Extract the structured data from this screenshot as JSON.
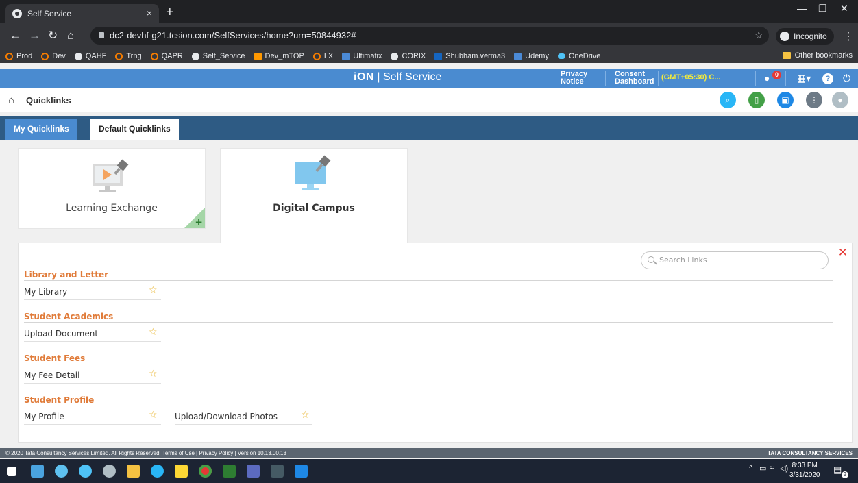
{
  "browser": {
    "tab_title": "Self Service",
    "close_glyph": "×",
    "newtab_glyph": "+",
    "url": "dc2-devhf-g21.tcsion.com/SelfServices/home?urn=50844932#",
    "incognito_label": "Incognito",
    "bookmarks": [
      {
        "label": "Prod",
        "icon": "ring"
      },
      {
        "label": "Dev",
        "icon": "ring"
      },
      {
        "label": "QAHF",
        "icon": "globe"
      },
      {
        "label": "Trng",
        "icon": "ring"
      },
      {
        "label": "QAPR",
        "icon": "ring"
      },
      {
        "label": "Self_Service",
        "icon": "globe"
      },
      {
        "label": "Dev_mTOP",
        "icon": "m"
      },
      {
        "label": "LX",
        "icon": "ring"
      },
      {
        "label": "Ultimatix",
        "icon": "sq"
      },
      {
        "label": "CORIX",
        "icon": "globe"
      },
      {
        "label": "Shubham.verma3",
        "icon": "o"
      },
      {
        "label": "Udemy",
        "icon": "sq"
      },
      {
        "label": "OneDrive",
        "icon": "cloud"
      }
    ],
    "other_bookmarks": "Other bookmarks"
  },
  "header": {
    "brand": "iON",
    "brand_suffix": "| Self Service",
    "privacy_line1": "Privacy",
    "privacy_line2": "Notice",
    "consent_line1": "Consent",
    "consent_line2": "Dashboard",
    "timezone": "(GMT+05:30) C...",
    "notification_count": "0"
  },
  "breadcrumb": {
    "title": "Quicklinks"
  },
  "tabs": {
    "my_quicklinks": "My Quicklinks",
    "default_quicklinks": "Default Quicklinks"
  },
  "tiles": [
    {
      "label": "Learning Exchange",
      "add_glyph": "+"
    },
    {
      "label": "Digital Campus"
    }
  ],
  "panel": {
    "search_placeholder": "Search Links",
    "close_glyph": "✕",
    "star_glyph": "☆",
    "sections": [
      {
        "title": "Library and Letter",
        "links": [
          "My Library"
        ]
      },
      {
        "title": "Student Academics",
        "links": [
          "Upload Document"
        ]
      },
      {
        "title": "Student Fees",
        "links": [
          "My Fee Detail"
        ]
      },
      {
        "title": "Student Profile",
        "links": [
          "My Profile",
          "Upload/Download Photos"
        ]
      }
    ]
  },
  "footer": {
    "text": "© 2020 Tata Consultancy Services Limited. All Rights Reserved.   Terms of Use | Privacy Policy | Version 10.13.00.13",
    "brand": "TATA CONSULTANCY SERVICES"
  },
  "taskbar": {
    "time": "8:33 PM",
    "date": "3/31/2020",
    "notification_count": "2"
  },
  "colors": {
    "app_blue": "#4a8bd0",
    "tab_bar": "#2e5b84",
    "section_orange": "#e07b39",
    "star": "#e9b52e",
    "timezone_yellow": "#f2ea3d"
  }
}
